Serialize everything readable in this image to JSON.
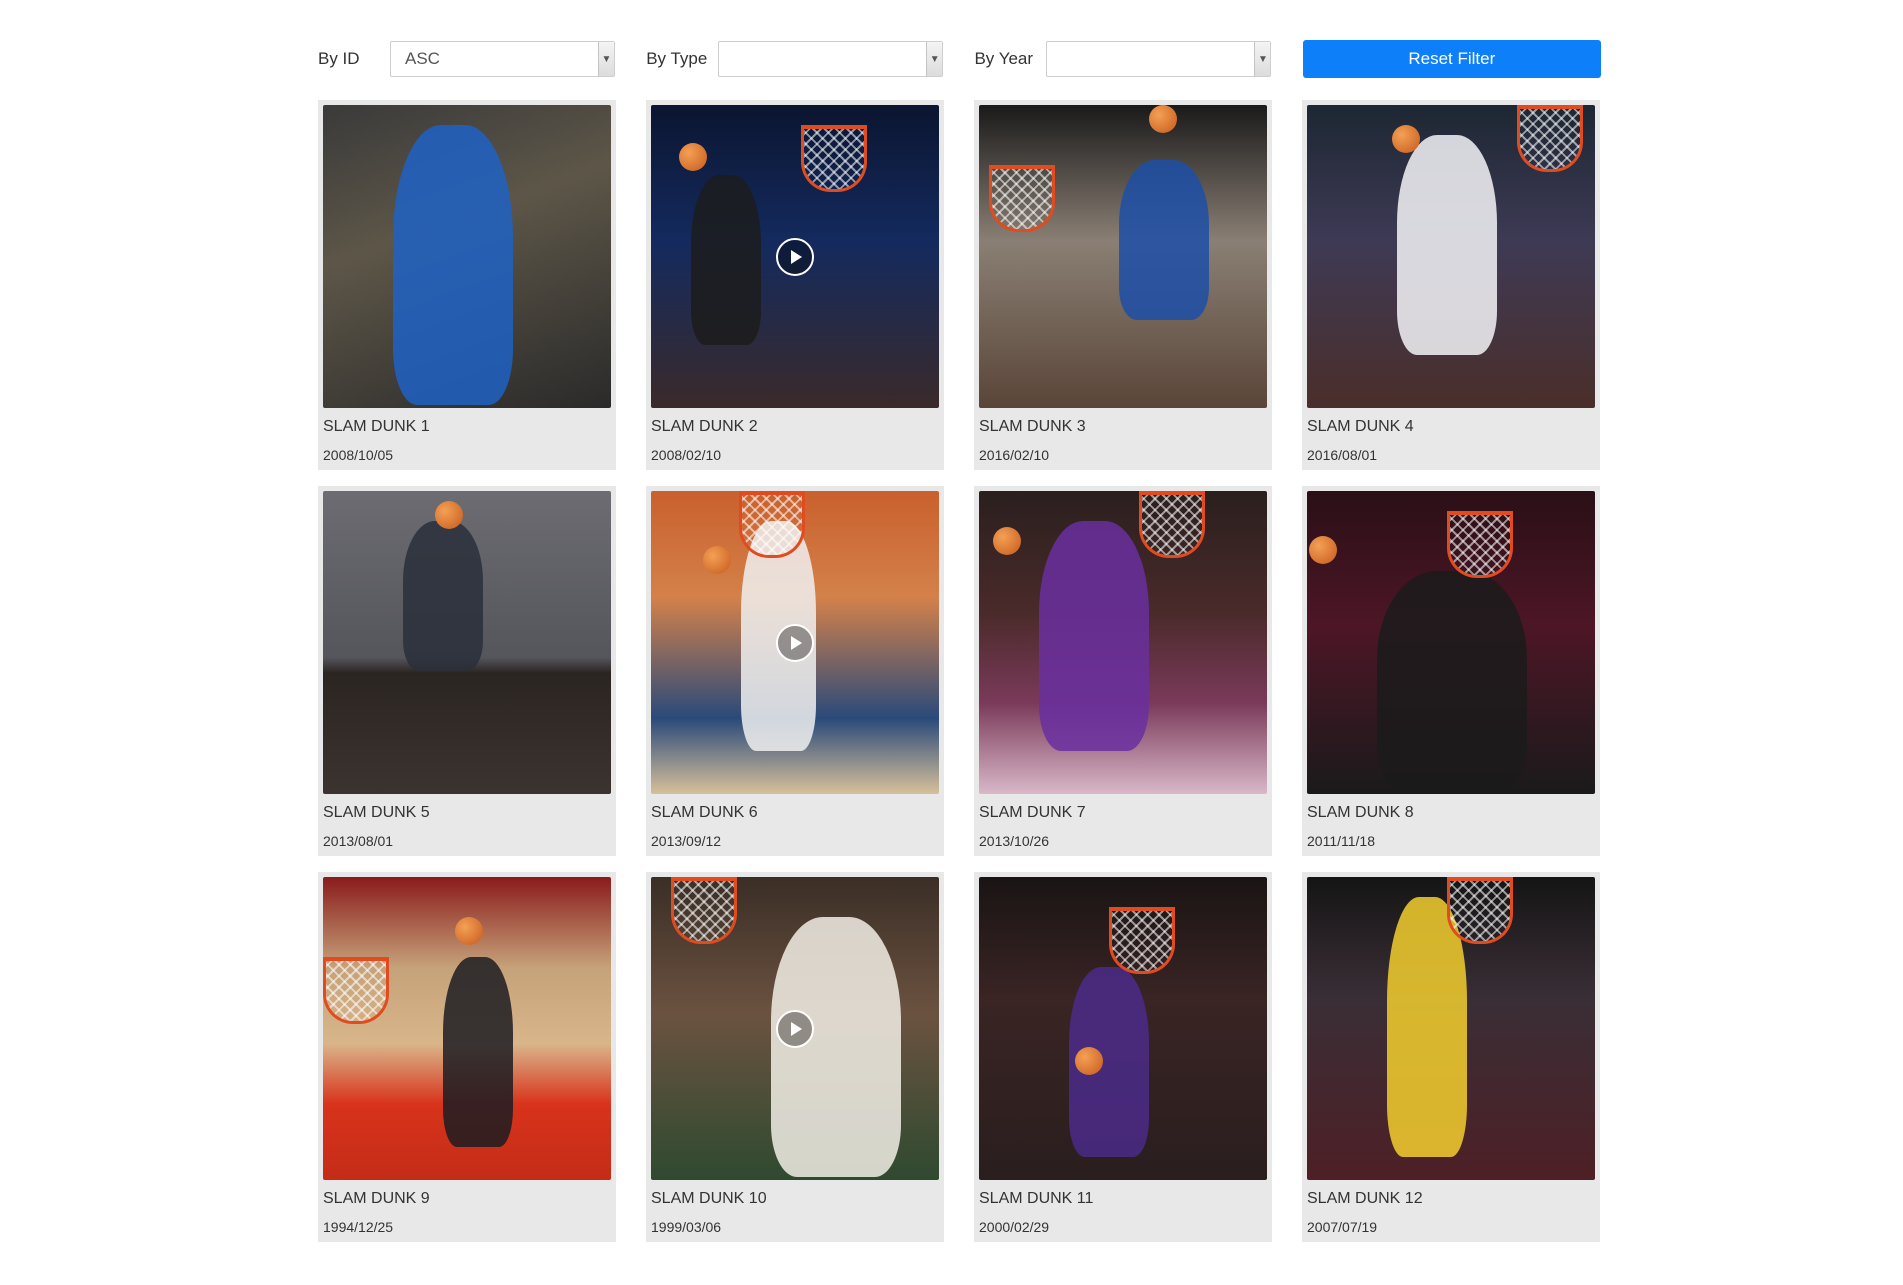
{
  "filters": {
    "by_id": {
      "label": "By ID",
      "value": "ASC"
    },
    "by_type": {
      "label": "By Type",
      "value": ""
    },
    "by_year": {
      "label": "By Year",
      "value": ""
    },
    "reset_label": "Reset Filter"
  },
  "colors": {
    "accent": "#0d7ff8",
    "card_bg": "#e8e8e8"
  },
  "cards": [
    {
      "title": "SLAM DUNK 1",
      "date": "2008/10/05",
      "video": false
    },
    {
      "title": "SLAM DUNK 2",
      "date": "2008/02/10",
      "video": true
    },
    {
      "title": "SLAM DUNK 3",
      "date": "2016/02/10",
      "video": false
    },
    {
      "title": "SLAM DUNK 4",
      "date": "2016/08/01",
      "video": false
    },
    {
      "title": "SLAM DUNK 5",
      "date": "2013/08/01",
      "video": false
    },
    {
      "title": "SLAM DUNK 6",
      "date": "2013/09/12",
      "video": true
    },
    {
      "title": "SLAM DUNK 7",
      "date": "2013/10/26",
      "video": false
    },
    {
      "title": "SLAM DUNK 8",
      "date": "2011/11/18",
      "video": false
    },
    {
      "title": "SLAM DUNK 9",
      "date": "1994/12/25",
      "video": false
    },
    {
      "title": "SLAM DUNK 10",
      "date": "1999/03/06",
      "video": true
    },
    {
      "title": "SLAM DUNK 11",
      "date": "2000/02/29",
      "video": false
    },
    {
      "title": "SLAM DUNK 12",
      "date": "2007/07/19",
      "video": false
    }
  ]
}
